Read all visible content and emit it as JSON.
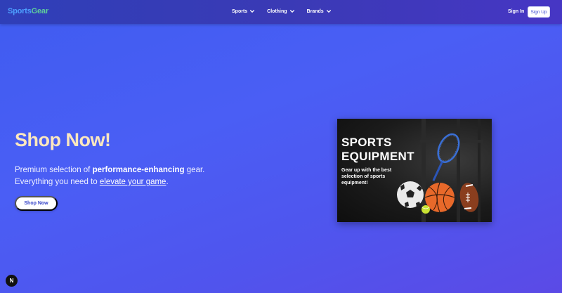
{
  "header": {
    "logo_part1": "Sports",
    "logo_part2": "Gear",
    "menu": [
      {
        "label": "Sports"
      },
      {
        "label": "Clothing"
      },
      {
        "label": "Brands"
      }
    ],
    "signin_label": "Sign In",
    "signup_label": "Sign Up"
  },
  "hero": {
    "title": "Shop Now!",
    "desc_part1": "Premium selection of ",
    "desc_bold": "performance-enhancing",
    "desc_part2": " gear. Everything you need to ",
    "desc_link": "elevate your game",
    "desc_part3": ".",
    "button_label": "Shop Now"
  },
  "promo": {
    "title_line1": "SPORTS",
    "title_line2": "EQUIPMENT",
    "subtitle": "Gear up with the best selection of sports equipment!"
  },
  "badge": {
    "label": "N"
  },
  "colors": {
    "logo_blue": "#4ea0ff",
    "logo_green": "#5fcf9a",
    "hero_title": "#fbe7bf",
    "background": "#4a5ef5"
  }
}
